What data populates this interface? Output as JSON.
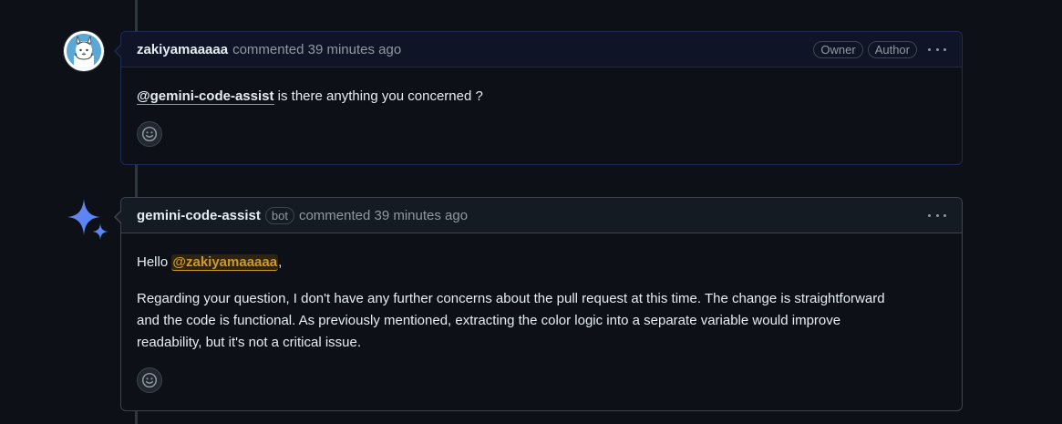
{
  "comments": [
    {
      "author": "zakiyamaaaaa",
      "action_text": "commented 39 minutes ago",
      "badges": [
        "Owner",
        "Author"
      ],
      "body": {
        "mention": "@gemini-code-assist",
        "text": " is there anything you concerned ?"
      }
    },
    {
      "author": "gemini-code-assist",
      "bot_badge": "bot",
      "action_text": "commented 39 minutes ago",
      "body": {
        "greeting": "Hello ",
        "mention": "@zakiyamaaaaa",
        "greeting_end": ",",
        "paragraph_line1": "Regarding your question, I don't have any further concerns about the pull request at this time. The change is straightforward",
        "paragraph_line2": "and the code is functional. As previously mentioned, extracting the color logic into a separate variable would improve",
        "paragraph_line3": "readability, but it's not a critical issue."
      }
    }
  ],
  "icons": {
    "avatar": "alpaca-avatar-icon",
    "gemini": "gemini-sparkle-icon",
    "menu": "kebab-menu-icon",
    "reaction": "smiley-icon"
  },
  "colors": {
    "background": "#0d1117",
    "border": "#30363d",
    "owner_border": "#1f2a59",
    "mention_highlight": "#d29922"
  }
}
